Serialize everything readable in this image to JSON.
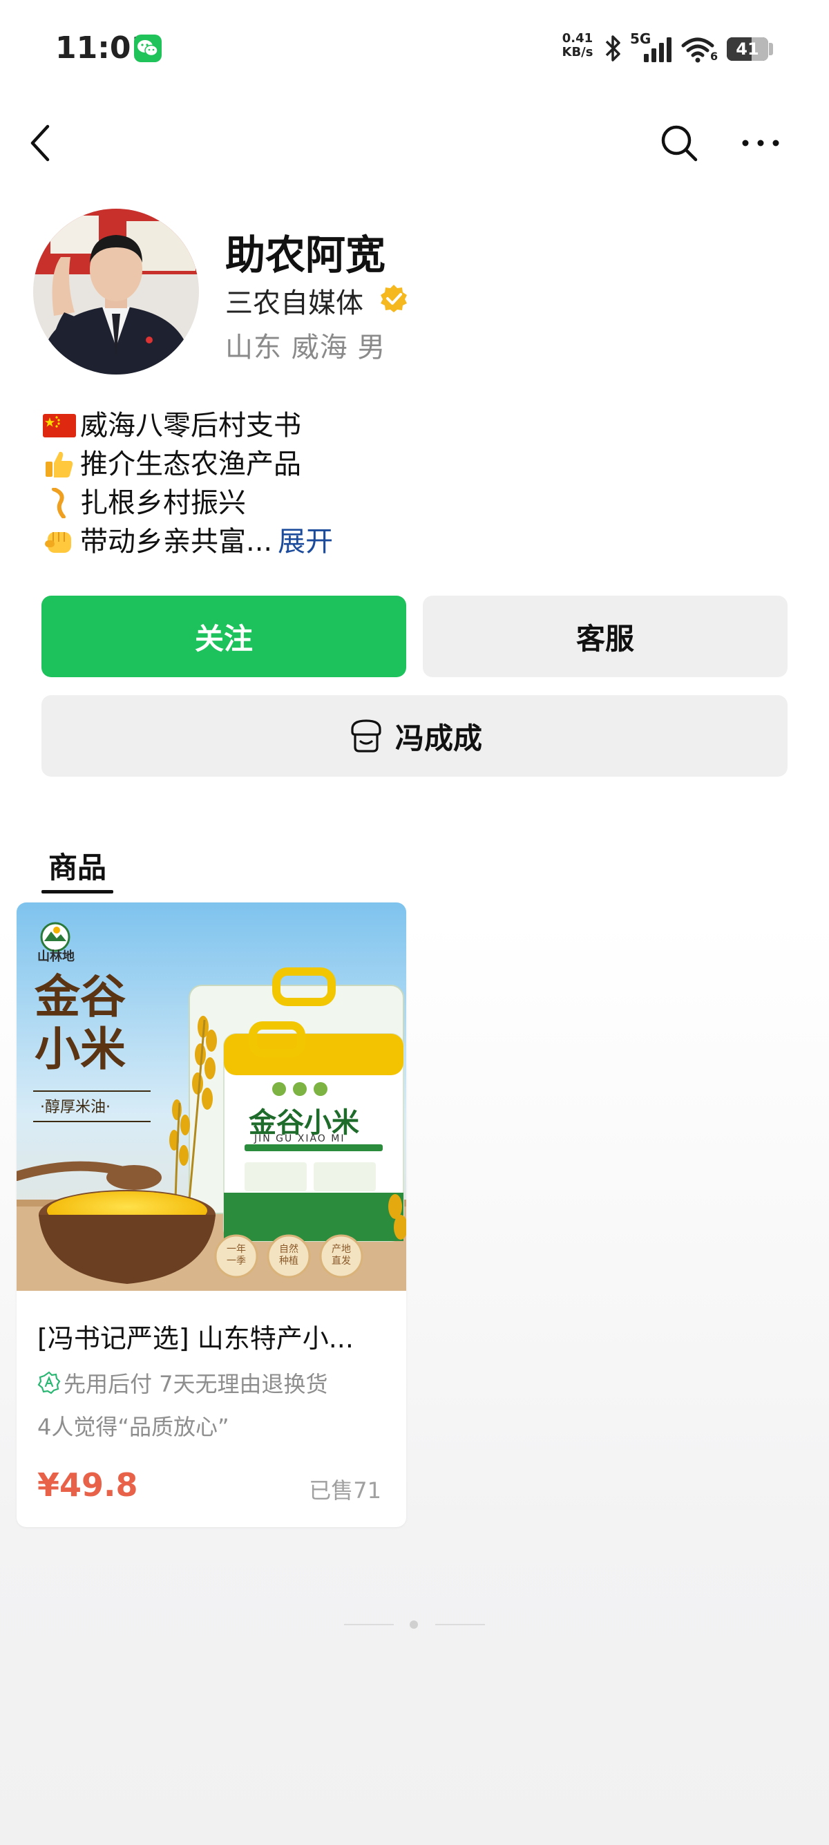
{
  "status_bar": {
    "time": "11:01",
    "net_speed_value": "0.41",
    "net_speed_unit": "KB/s",
    "network": "5G",
    "wifi_level": "6",
    "battery": "41"
  },
  "nav": {
    "back_icon": "chevron-left-icon",
    "search_icon": "search-icon",
    "more_icon": "more-icon"
  },
  "profile": {
    "name": "助农阿宽",
    "category": "三农自媒体",
    "location": "山东 威海 男"
  },
  "bio": {
    "lines": [
      {
        "icon": "china-flag-icon",
        "text": "威海八零后村支书"
      },
      {
        "icon": "thumbs-up-icon",
        "text": "推介生态农渔产品"
      },
      {
        "icon": "root-icon",
        "text": "扎根乡村振兴"
      },
      {
        "icon": "fist-icon",
        "text": "带动乡亲共富..."
      }
    ],
    "expand_label": "展开"
  },
  "actions": {
    "follow_label": "关注",
    "service_label": "客服",
    "shop_label": "冯成成"
  },
  "tabs": [
    {
      "label": "商品",
      "active": true
    }
  ],
  "products": [
    {
      "title": "[冯书记严选] 山东特产小...",
      "service_tags": "先用后付 7天无理由退换货",
      "review": "4人觉得“品质放心”",
      "price": "¥49.8",
      "sold": "已售71",
      "image": {
        "brand": "山林地",
        "headline_1": "金谷",
        "headline_2": "小米",
        "slogan": "·醇厚米油·",
        "bag_title": "金谷小米",
        "bag_subtitle": "JIN GU XIAO MI",
        "badges": [
          "一年一季",
          "自然种植",
          "产地直发"
        ]
      }
    }
  ],
  "colors": {
    "accent_green": "#1ec25c",
    "price_red": "#e8624a",
    "link_blue": "#1b4b9a"
  }
}
